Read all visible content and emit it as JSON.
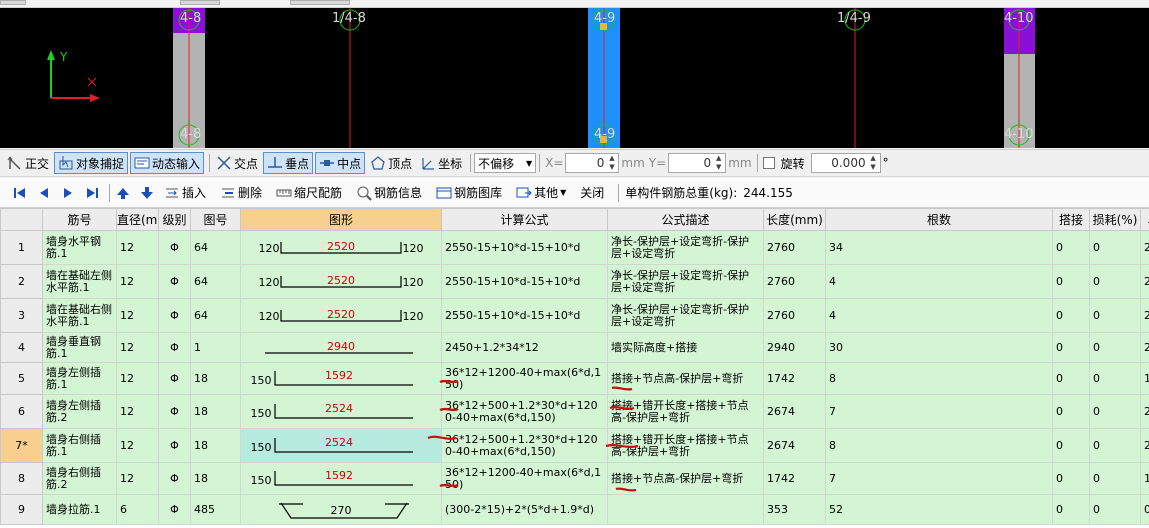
{
  "canvas": {
    "axes": [
      {
        "label": "4-8",
        "side": "left"
      },
      {
        "label": "1/4-8",
        "side": "mid"
      },
      {
        "label": "4-9",
        "side": "blue"
      },
      {
        "label": "1/4-9",
        "side": "mid"
      },
      {
        "label": "4-10",
        "side": "right"
      }
    ],
    "ucs_y": "Y",
    "ucs_x": "X",
    "colors": {
      "bg": "#000000",
      "column_gray": "#b3b3b3",
      "column_purple": "#8a0fd8",
      "column_blue": "#1e8fff",
      "line_red": "#e02020",
      "circle_green": "#18c018"
    }
  },
  "toolbar1": {
    "ortho": "正交",
    "snap": "对象捕捉",
    "dynamic": "动态输入",
    "intersection": "交点",
    "perpendicular": "垂点",
    "midpoint": "中点",
    "vertex": "顶点",
    "coordinate": "坐标",
    "offset_value": "不偏移",
    "x_label": "X=",
    "x_value": "0",
    "mm1": "mm",
    "y_label": "Y=",
    "y_value": "0",
    "mm2": "mm",
    "rotate_label": "旋转",
    "rotate_value": "0.000",
    "degree": "°"
  },
  "toolbar2": {
    "insert": "插入",
    "delete": "删除",
    "scale": "缩尺配筋",
    "rebar_info": "钢筋信息",
    "rebar_library": "钢筋图库",
    "other": "其他",
    "close": "关闭",
    "total_label": "单构件钢筋总重(kg):",
    "total_value": "244.155"
  },
  "table": {
    "headers": [
      "筋号",
      "直径(mm)",
      "级别",
      "图号",
      "图形",
      "计算公式",
      "公式描述",
      "长度(mm)",
      "根数",
      "搭接",
      "损耗(%)",
      "单"
    ],
    "rows": [
      {
        "num": "1",
        "name": "墙身水平钢筋.1",
        "dia": "12",
        "grade": "Φ",
        "fig": "64",
        "shape": {
          "type": "u",
          "left": "120",
          "mid": "2520",
          "right": "120"
        },
        "formula": "2550-15+10*d-15+10*d",
        "desc": "净长-保护层+设定弯折-保护层+设定弯折",
        "length": "2760",
        "count": "34",
        "lap": "0",
        "loss": "0",
        "unit": "2."
      },
      {
        "num": "2",
        "name": "墙在基础左侧水平筋.1",
        "dia": "12",
        "grade": "Φ",
        "fig": "64",
        "shape": {
          "type": "u",
          "left": "120",
          "mid": "2520",
          "right": "120"
        },
        "formula": "2550-15+10*d-15+10*d",
        "desc": "净长-保护层+设定弯折-保护层+设定弯折",
        "length": "2760",
        "count": "4",
        "lap": "0",
        "loss": "0",
        "unit": "2."
      },
      {
        "num": "3",
        "name": "墙在基础右侧水平筋.1",
        "dia": "12",
        "grade": "Φ",
        "fig": "64",
        "shape": {
          "type": "u",
          "left": "120",
          "mid": "2520",
          "right": "120"
        },
        "formula": "2550-15+10*d-15+10*d",
        "desc": "净长-保护层+设定弯折-保护层+设定弯折",
        "length": "2760",
        "count": "4",
        "lap": "0",
        "loss": "0",
        "unit": "2."
      },
      {
        "num": "4",
        "name": "墙身垂直钢筋.1",
        "dia": "12",
        "grade": "Φ",
        "fig": "1",
        "shape": {
          "type": "line",
          "mid": "2940"
        },
        "formula": "2450+1.2*34*12",
        "desc": "墙实际高度+搭接",
        "length": "2940",
        "count": "30",
        "lap": "0",
        "loss": "0",
        "unit": "2."
      },
      {
        "num": "5",
        "name": "墙身左侧插筋.1",
        "dia": "12",
        "grade": "Φ",
        "fig": "18",
        "shape": {
          "type": "l",
          "left": "150",
          "mid": "1592"
        },
        "formula": "36*12+1200-40+max(6*d,150)",
        "desc": "搭接+节点高-保护层+弯折",
        "length": "1742",
        "count": "8",
        "lap": "0",
        "loss": "0",
        "unit": "1."
      },
      {
        "num": "6",
        "name": "墙身左侧插筋.2",
        "dia": "12",
        "grade": "Φ",
        "fig": "18",
        "shape": {
          "type": "l",
          "left": "150",
          "mid": "2524"
        },
        "formula": "36*12+500+1.2*30*d+1200-40+max(6*d,150)",
        "desc": "搭接+错开长度+搭接+节点高-保护层+弯折",
        "length": "2674",
        "count": "7",
        "lap": "0",
        "loss": "0",
        "unit": "2."
      },
      {
        "num": "7*",
        "name": "墙身右侧插筋.1",
        "dia": "12",
        "grade": "Φ",
        "fig": "18",
        "shape": {
          "type": "l",
          "left": "150",
          "mid": "2524"
        },
        "formula": "36*12+500+1.2*30*d+1200-40+max(6*d,150)",
        "desc": "搭接+错开长度+搭接+节点高-保护层+弯折",
        "length": "2674",
        "count": "8",
        "lap": "0",
        "loss": "0",
        "unit": "2."
      },
      {
        "num": "8",
        "name": "墙身右侧插筋.2",
        "dia": "12",
        "grade": "Φ",
        "fig": "18",
        "shape": {
          "type": "l",
          "left": "150",
          "mid": "1592"
        },
        "formula": "36*12+1200-40+max(6*d,150)",
        "desc": "搭接+节点高-保护层+弯折",
        "length": "1742",
        "count": "7",
        "lap": "0",
        "loss": "0",
        "unit": "1."
      },
      {
        "num": "9",
        "name": "墙身拉筋.1",
        "dia": "6",
        "grade": "Φ",
        "fig": "485",
        "shape": {
          "type": "tie",
          "mid": "270"
        },
        "formula": "(300-2*15)+2*(5*d+1.9*d)",
        "desc": "",
        "length": "353",
        "count": "52",
        "lap": "0",
        "loss": "0",
        "unit": "0."
      }
    ]
  }
}
